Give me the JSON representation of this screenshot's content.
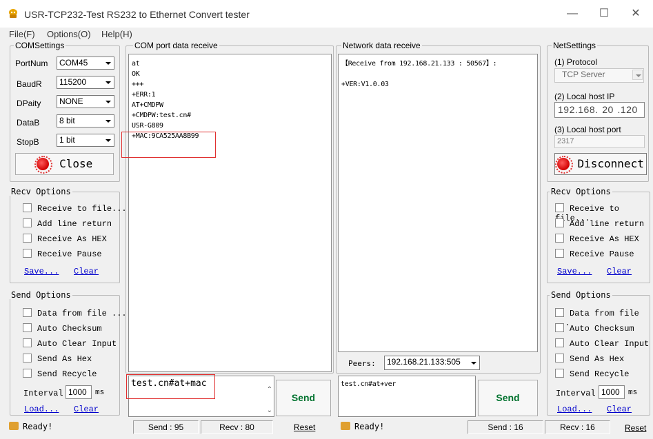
{
  "window": {
    "title": "USR-TCP232-Test  RS232 to Ethernet Convert tester",
    "min_icon": "minimize-icon",
    "max_icon": "maximize-icon",
    "close_icon": "close-icon"
  },
  "menu": [
    "File(F)",
    "Options(O)",
    "Help(H)"
  ],
  "com_settings": {
    "title": "COMSettings",
    "port_label": "PortNum",
    "port_value": "COM45",
    "baud_label": "BaudR",
    "baud_value": "115200",
    "parity_label": "DPaity",
    "parity_value": "NONE",
    "databits_label": "DataB",
    "databits_value": "8 bit",
    "stopbits_label": "StopB",
    "stopbits_value": "1 bit",
    "close_button": "Close"
  },
  "left_recv_options": {
    "title": "Recv Options",
    "items": [
      "Receive to file...",
      "Add line return",
      "Receive As HEX",
      "Receive Pause"
    ],
    "save": "Save...",
    "clear": "Clear"
  },
  "left_send_options": {
    "title": "Send Options",
    "items": [
      "Data from file ...",
      "Auto Checksum",
      "Auto Clear Input",
      "Send As Hex",
      "Send Recycle"
    ],
    "interval_label": "Interval",
    "interval_value": "1000",
    "interval_unit": "ms",
    "load": "Load...",
    "clear": "Clear"
  },
  "com_receive": {
    "title": "COM port data receive",
    "lines": [
      "at",
      "OK",
      "+++",
      "+ERR:1",
      "AT+CMDPW",
      "+CMDPW:test.cn#",
      "USR-G809",
      "+MAC:9CA525AA8B99"
    ]
  },
  "com_send": {
    "text": "test.cn#at+mac",
    "send_button": "Send"
  },
  "net_receive": {
    "title": "Network data receive",
    "lines": [
      "【Receive from 192.168.21.133 : 50567】:",
      "",
      "+VER:V1.0.03"
    ]
  },
  "peers": {
    "label": "Peers:",
    "value": "192.168.21.133:505"
  },
  "net_send": {
    "text": "test.cn#at+ver",
    "send_button": "Send"
  },
  "net_settings": {
    "title": "NetSettings",
    "protocol_label": "(1) Protocol",
    "protocol_value": "TCP Server",
    "local_ip_label": "(2) Local host IP",
    "ip_parts": [
      "192",
      "168",
      "20",
      "120"
    ],
    "local_port_label": "(3) Local host port",
    "local_port_value": "2317",
    "disconnect_button": "Disconnect"
  },
  "right_recv_options": {
    "title": "Recv Options",
    "items": [
      "Receive to file...",
      "Add line return",
      "Receive As HEX",
      "Receive Pause"
    ],
    "save": "Save...",
    "clear": "Clear"
  },
  "right_send_options": {
    "title": "Send Options",
    "items": [
      "Data from file ...",
      "Auto Checksum",
      "Auto Clear Input",
      "Send As Hex",
      "Send Recycle"
    ],
    "interval_label": "Interval",
    "interval_value": "1000",
    "interval_unit": "ms",
    "load": "Load...",
    "clear": "Clear"
  },
  "status_left": {
    "ready": "Ready!",
    "send": "Send : 95",
    "recv": "Recv : 80",
    "reset": "Reset"
  },
  "status_right": {
    "ready": "Ready!",
    "send": "Send : 16",
    "recv": "Recv : 16",
    "reset": "Reset"
  },
  "colors": {
    "highlight": "#e03030",
    "send_green": "#00722e",
    "link_blue": "#0000cc"
  }
}
